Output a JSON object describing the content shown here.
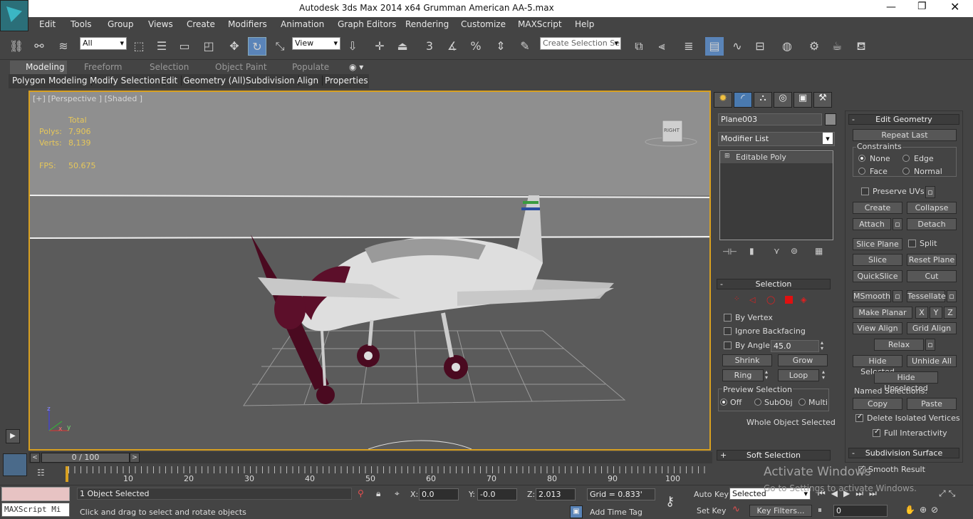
{
  "title": "Autodesk 3ds Max  2014 x64    Grumman American AA-5.max",
  "menu": [
    "Edit",
    "Tools",
    "Group",
    "Views",
    "Create",
    "Modifiers",
    "Animation",
    "Graph Editors",
    "Rendering",
    "Customize",
    "MAXScript",
    "Help"
  ],
  "toolbar": {
    "filter_value": "All",
    "refcoord_value": "View",
    "selset_value": "Create Selection Se",
    "snap_labels": [
      "3",
      "%"
    ]
  },
  "ribbon": {
    "tabs": [
      "Modeling",
      "Freeform",
      "Selection",
      "Object Paint",
      "Populate"
    ],
    "groups": [
      "Polygon Modeling",
      "Modify Selection",
      "Edit",
      "Geometry (All)",
      "Subdivision",
      "Align",
      "Properties"
    ]
  },
  "viewport": {
    "label": "[+] [Perspective ] [Shaded ]",
    "stats": {
      "total": "Total",
      "polys_label": "Polys:",
      "polys": "7,906",
      "verts_label": "Verts:",
      "verts": "8,139",
      "fps_label": "FPS:",
      "fps": "50.675"
    },
    "viewcube": "RIGHT",
    "axis": {
      "z": "z",
      "x": "x",
      "y": "y"
    }
  },
  "cmdpanel": {
    "object_name": "Plane003",
    "modifier_list": "Modifier List",
    "stack_item": "Editable Poly",
    "selection": {
      "header": "Selection",
      "by_vertex": "By Vertex",
      "ignore_backfacing": "Ignore Backfacing",
      "by_angle": "By Angle:",
      "angle_value": "45.0",
      "shrink": "Shrink",
      "grow": "Grow",
      "ring": "Ring",
      "loop": "Loop",
      "preview": "Preview Selection",
      "off": "Off",
      "subobj": "SubObj",
      "multi": "Multi",
      "status": "Whole Object Selected"
    },
    "soft_selection": "Soft Selection"
  },
  "rollout": {
    "header": "Edit Geometry",
    "repeat_last": "Repeat Last",
    "constraints": "Constraints",
    "none": "None",
    "edge": "Edge",
    "face": "Face",
    "normal": "Normal",
    "preserve_uvs": "Preserve UVs",
    "create": "Create",
    "collapse": "Collapse",
    "attach": "Attach",
    "detach": "Detach",
    "slice_plane": "Slice Plane",
    "split": "Split",
    "slice": "Slice",
    "reset_plane": "Reset Plane",
    "quickslice": "QuickSlice",
    "cut": "Cut",
    "msmooth": "MSmooth",
    "tessellate": "Tessellate",
    "make_planar": "Make Planar",
    "x": "X",
    "y": "Y",
    "z": "Z",
    "view_align": "View Align",
    "grid_align": "Grid Align",
    "relax": "Relax",
    "hide_selected": "Hide Selected",
    "unhide_all": "Unhide All",
    "hide_unselected": "Hide Unselected",
    "named_selections": "Named Selections:",
    "copy": "Copy",
    "paste": "Paste",
    "delete_isolated": "Delete Isolated Vertices",
    "full_interactivity": "Full Interactivity",
    "subdiv_header": "Subdivision Surface",
    "smooth_result": "Smooth Result"
  },
  "timeline": {
    "frame": "0 / 100",
    "ticks": [
      "10",
      "20",
      "30",
      "40",
      "50",
      "60",
      "70",
      "80",
      "90",
      "100"
    ]
  },
  "status": {
    "maxscript": "MAXScript Mi",
    "selected": "1 Object Selected",
    "prompt": "Click and drag to select and rotate objects",
    "x_label": "X:",
    "x": "0.0",
    "y_label": "Y:",
    "y": "-0.0",
    "z_label": "Z:",
    "z": "2.013",
    "grid": "Grid = 0.833'",
    "add_time_tag": "Add Time Tag",
    "auto_key": "Auto Key",
    "set_key": "Set Key",
    "selected_drop": "Selected",
    "key_filters": "Key Filters...",
    "frame_field": "0"
  },
  "watermark": {
    "line1": "Activate Windows",
    "line2": "Go to Settings to activate Windows."
  }
}
